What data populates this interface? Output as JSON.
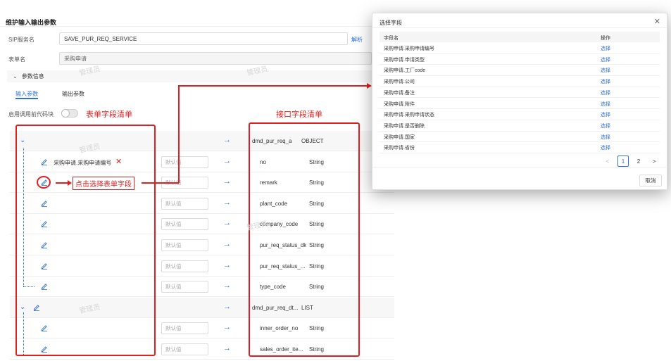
{
  "page": {
    "title": "维护输入输出参数",
    "sip_label": "SIP服务名",
    "sip_value": "SAVE_PUR_REQ_SERVICE",
    "parse_link": "解析",
    "form_label": "表单名",
    "form_value": "采购申请",
    "section_title": "参数信息",
    "tab_input": "输入参数",
    "tab_output": "输出参数",
    "toggle_label": "启用调用前代码块",
    "default_placeholder": "默认值",
    "watermark": "管理员"
  },
  "annotations": {
    "form_fields": "表单字段清单",
    "iface_fields": "接口字段清单",
    "click_hint": "点击选择表单字段"
  },
  "rows": [
    {
      "form_field": "",
      "iface_name": "dmd_pur_req_a",
      "iface_type": "OBJECT"
    },
    {
      "form_field": "采购申请.采购申请编号",
      "iface_name": "no",
      "iface_type": "String"
    },
    {
      "form_field": "",
      "iface_name": "remark",
      "iface_type": "String"
    },
    {
      "form_field": "",
      "iface_name": "plant_code",
      "iface_type": "String"
    },
    {
      "form_field": "",
      "iface_name": "company_code",
      "iface_type": "String"
    },
    {
      "form_field": "",
      "iface_name": "pur_req_status_dk",
      "iface_type": "String"
    },
    {
      "form_field": "",
      "iface_name": "pur_req_status_...",
      "iface_type": "String"
    },
    {
      "form_field": "",
      "iface_name": "type_code",
      "iface_type": "String"
    },
    {
      "form_field": "",
      "iface_name": "dmd_pur_req_dt...",
      "iface_type": "LIST"
    },
    {
      "form_field": "",
      "iface_name": "inner_order_no",
      "iface_type": "String"
    },
    {
      "form_field": "",
      "iface_name": "sales_order_ite...",
      "iface_type": "String"
    }
  ],
  "modal": {
    "title": "选择字段",
    "col_name": "字段名",
    "col_op": "操作",
    "select_label": "选择",
    "items": [
      "采购申请.采购申请编号",
      "采购申请.申请类型",
      "采购申请.工厂code",
      "采购申请.公司",
      "采购申请.备注",
      "采购申请.附件",
      "采购申请.采购申请状态",
      "采购申请.是否删除",
      "采购申请.国家",
      "采购申请.省份"
    ],
    "pager": {
      "prev": "<",
      "page1": "1",
      "page2": "2",
      "next": ">"
    },
    "cancel": "取消"
  },
  "icons": {
    "pencil": "pencil-icon",
    "arrow": "arrow-right-icon",
    "chevron": "chevron-down-icon",
    "delete": "close-icon"
  },
  "colors": {
    "accent": "#2f6fd6",
    "annotation": "#e02020"
  }
}
